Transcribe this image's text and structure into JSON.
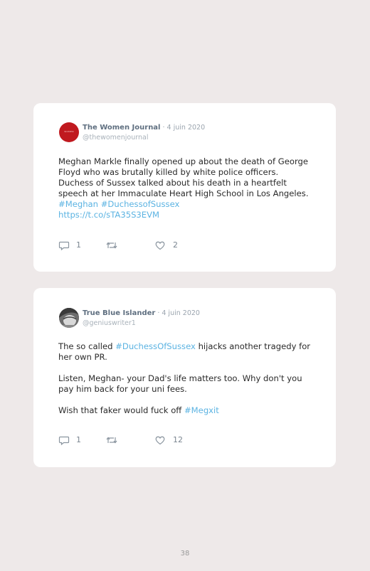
{
  "tweets": [
    {
      "author": "The Women Journal",
      "date": " · 4 juin 2020",
      "handle": "@thewomenjournal",
      "avatar_label": "WOMEN",
      "body": {
        "line1": "Meghan Markle finally opened up about the death of George Floyd who was brutally killed by white police officers. Duchess of Sussex talked about his death in a heartfelt speech at her Immaculate Heart High School in Los Angeles. ",
        "tag1": "#Meghan",
        "tag2": "#DuchessofSussex",
        "url": "https://t.co/sTA35S3EVM"
      },
      "replies": "1",
      "likes": "2"
    },
    {
      "author": "True Blue Islander",
      "date": " · 4 juin 2020",
      "handle": "@geniuswriter1",
      "body": {
        "p1_start": "The so called ",
        "p1_tag": "#DuchessOfSussex",
        "p1_end": " hijacks another tragedy for her own PR.",
        "p2": "Listen, Meghan- your Dad's life matters too. Why don't you pay him back for your uni fees.",
        "p3_start": "Wish that faker would fuck off ",
        "p3_tag": "#Megxit"
      },
      "replies": "1",
      "likes": "12"
    }
  ],
  "colors": {
    "background": "#eee9e9",
    "link": "#5bb3e2",
    "icon": "#8a959f"
  },
  "icons": [
    "reply-icon",
    "retweet-icon",
    "like-icon"
  ],
  "page_number": "38"
}
